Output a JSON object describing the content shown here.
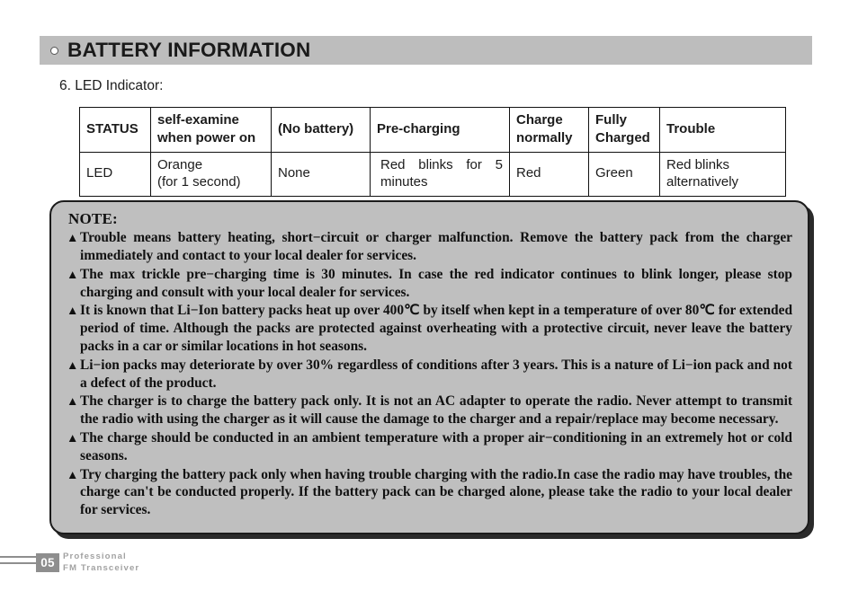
{
  "header": {
    "bullet_icon": "ring-bullet-icon",
    "title": "BATTERY INFORMATION",
    "band_color": "#bdbdbd"
  },
  "section": {
    "label": "6. LED Indicator:"
  },
  "led_table": {
    "columns": [
      "STATUS",
      "self-examine when power on",
      "(No battery)",
      "Pre-charging",
      "Charge normally",
      "Fully Charged",
      "Trouble"
    ],
    "header_cells": {
      "status": "STATUS",
      "self_examine_line1": "self-examine",
      "self_examine_line2": "when power on",
      "no_battery": "(No battery)",
      "pre_charging": "Pre-charging",
      "charge_normally_line1": "Charge",
      "charge_normally_line2": "normally",
      "fully_charged_line1": "Fully",
      "fully_charged_line2": "Charged",
      "trouble": "Trouble"
    },
    "rows": [
      {
        "status": "LED",
        "self_examine_line1": "Orange",
        "self_examine_line2": "(for 1 second)",
        "no_battery": "None",
        "pre_charging": "Red blinks for 5 minutes",
        "charge_normally": "Red",
        "fully_charged": "Green",
        "trouble_line1": "Red blinks",
        "trouble_line2": "alternatively"
      }
    ]
  },
  "note": {
    "heading": "NOTE:",
    "bullet_glyph": "▲",
    "background_color": "#bfbfbf",
    "items": [
      "Trouble means battery heating, short−circuit or charger malfunction. Remove the battery pack from the charger immediately and contact to your local dealer for services.",
      "The max trickle pre−charging time is 30 minutes. In case the red indicator continues to blink longer, please stop charging and consult with your local dealer for services.",
      "It is known that Li−Ion battery packs heat up over 400℃ by itself when kept in a temperature of over 80℃ for extended period of time. Although the packs are protected against overheating with a protective circuit, never leave the battery packs in a car or similar locations in hot seasons.",
      "Li−ion packs may deteriorate by over 30% regardless of conditions after 3 years. This is a nature of Li−ion pack and not a defect of the product.",
      "The charger is to charge the battery pack only. It is not an AC adapter to operate the radio. Never attempt to transmit the radio with using the charger as it will cause the damage to the charger and a repair/replace may become necessary.",
      "The charge should be conducted in an ambient temperature with a proper air−conditioning in an extremely hot or cold seasons.",
      "Try charging the battery pack only when having trouble charging with the radio.In case the radio may have troubles, the charge can't be conducted properly. If the battery pack can be charged alone, please take the radio to your local dealer for services."
    ]
  },
  "footer": {
    "page_number": "05",
    "brand_line1": "Professional",
    "brand_line2": "FM Transceiver",
    "accent_color": "#8e8e8e"
  }
}
